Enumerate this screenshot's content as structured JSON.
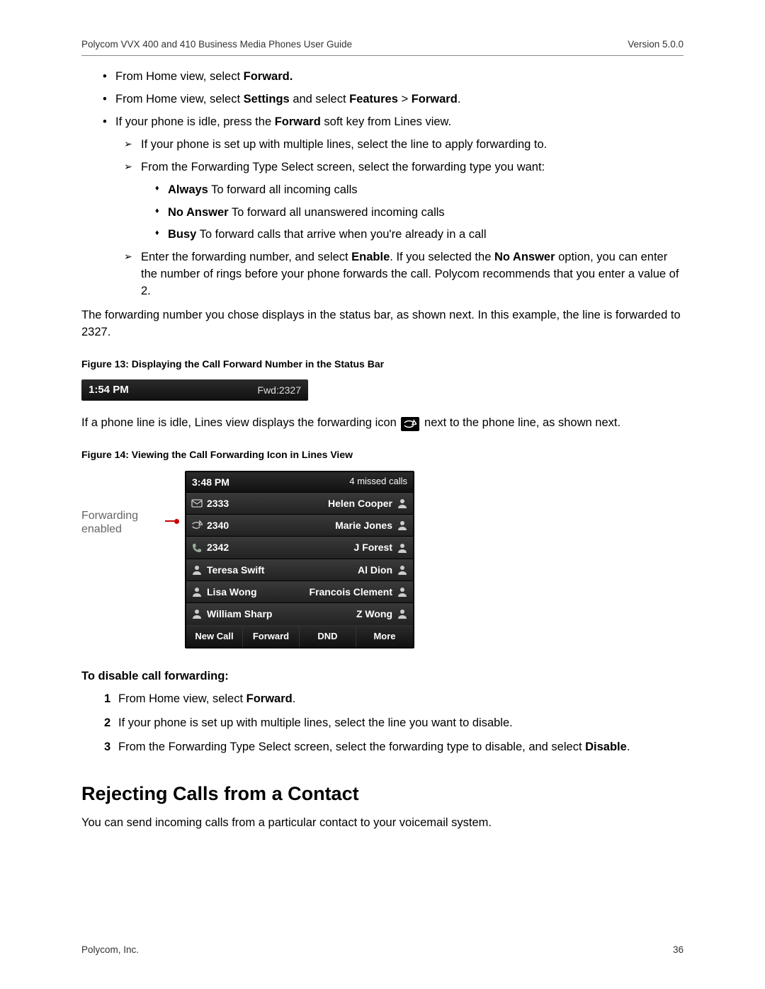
{
  "header": {
    "title": "Polycom VVX 400 and 410 Business Media Phones User Guide",
    "version": "Version 5.0.0"
  },
  "list1": {
    "a_pre": "From Home view, select ",
    "a_b": "Forward.",
    "b_pre": "From Home view, select ",
    "b_b1": "Settings",
    "b_mid": " and select ",
    "b_b2": "Features",
    "b_gt": " > ",
    "b_b3": "Forward",
    "b_post": ".",
    "c_pre": "If your phone is idle, press the ",
    "c_b": "Forward",
    "c_post": " soft key from Lines view."
  },
  "arrows": {
    "a": "If your phone is set up with multiple lines, select the line to apply forwarding to.",
    "b": "From the Forwarding Type Select screen, select the forwarding type you want:",
    "c_pre": "Enter the forwarding number, and select ",
    "c_b1": "Enable",
    "c_mid": ". If you selected the ",
    "c_b2": "No Answer",
    "c_post": " option, you can enter the number of rings before your phone forwards the call. Polycom recommends that you enter a value of 2."
  },
  "diam": {
    "a_b": "Always",
    "a_t": "   To forward all incoming calls",
    "b_b": "No Answer",
    "b_t": "   To forward all unanswered incoming calls",
    "c_b": "Busy",
    "c_t": "   To forward calls that arrive when you're already in a call"
  },
  "para1": "The forwarding number you chose displays in the status bar, as shown next. In this example, the line is forwarded to 2327.",
  "fig13": "Figure 13: Displaying the Call Forward Number in the Status Bar",
  "statusbar": {
    "time": "1:54 PM",
    "fwd": "Fwd:2327"
  },
  "para2_pre": "If a phone line is idle, Lines view displays the forwarding icon ",
  "para2_post": " next to the phone line, as shown next.",
  "fig14": "Figure 14: Viewing the Call Forwarding Icon in Lines View",
  "linesLabel1": "Forwarding",
  "linesLabel2": "enabled",
  "linesView": {
    "time": "3:48 PM",
    "missed": "4 missed calls",
    "left": [
      {
        "icon": "envelope",
        "text": "2333"
      },
      {
        "icon": "forward",
        "text": "2340"
      },
      {
        "icon": "phone",
        "text": "2342"
      },
      {
        "icon": "person",
        "text": "Teresa Swift"
      },
      {
        "icon": "person",
        "text": "Lisa Wong"
      },
      {
        "icon": "person",
        "text": "William Sharp"
      }
    ],
    "right": [
      {
        "text": "Helen Cooper",
        "icon": "person"
      },
      {
        "text": "Marie Jones",
        "icon": "person"
      },
      {
        "text": "J Forest",
        "icon": "person"
      },
      {
        "text": "Al Dion",
        "icon": "person"
      },
      {
        "text": "Francois Clement",
        "icon": "person"
      },
      {
        "text": "Z Wong",
        "icon": "person"
      }
    ],
    "softkeys": [
      "New Call",
      "Forward",
      "DND",
      "More"
    ]
  },
  "disableHead": "To disable call forwarding:",
  "steps": {
    "s1_pre": "From Home view, select ",
    "s1_b": "Forward",
    "s1_post": ".",
    "s2": "If your phone is set up with multiple lines, select the line you want to disable.",
    "s3_pre": "From the Forwarding Type Select screen, select the forwarding type to disable, and select ",
    "s3_b": "Disable",
    "s3_post": "."
  },
  "rejectHead": "Rejecting Calls from a Contact",
  "rejectPara": "You can send incoming calls from a particular contact to your voicemail system.",
  "footer": {
    "company": "Polycom, Inc.",
    "page": "36"
  }
}
